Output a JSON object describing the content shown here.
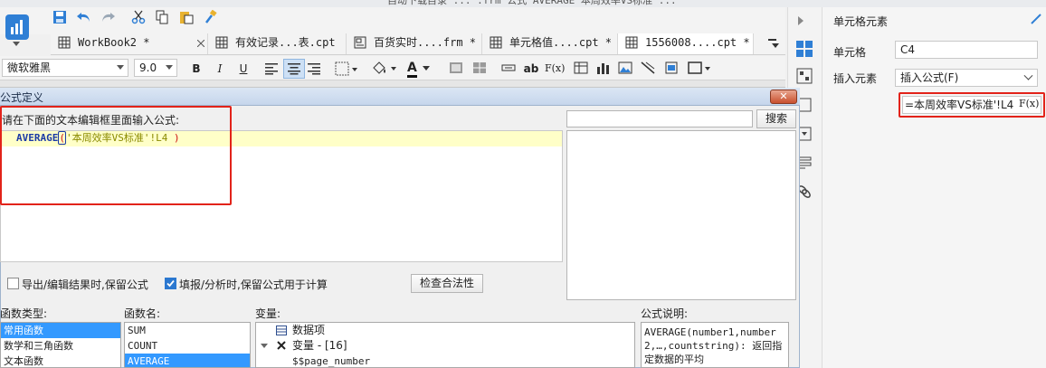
{
  "window": {
    "title_partial": "自动下载目录 ... .frm 公式 AVERAGE 本周效率VS标准 ..."
  },
  "toolbar": {
    "save": "save",
    "undo": "undo",
    "redo": "redo",
    "cut": "cut",
    "copy": "copy",
    "paste": "paste",
    "format_painter": "brush"
  },
  "tabs": [
    {
      "label": "WorkBook2 *"
    },
    {
      "label": "有效记录...表.cpt"
    },
    {
      "label": "百货实时....frm *"
    },
    {
      "label": "单元格值....cpt *"
    },
    {
      "label": "1556008....cpt *"
    }
  ],
  "format": {
    "font_name": "微软雅黑",
    "font_size": "9.0",
    "bold": "B",
    "italic": "I",
    "underline": "U",
    "text_a": "A",
    "ab": "ab",
    "fx": "F(x)"
  },
  "dialog": {
    "title": "公式定义",
    "close": "✕",
    "prompt": "请在下面的文本编辑框里面输入公式:",
    "search_btn": "搜索",
    "search_value": "",
    "formula": {
      "func": "AVERAGE",
      "open": "(",
      "arg": "'本周效率VS标准'!L4",
      "close": ")"
    },
    "export_label": "导出/编辑结果时,保留公式",
    "export_checked": false,
    "fill_label": "填报/分析时,保留公式用于计算",
    "fill_checked": true,
    "check_btn": "检查合法性",
    "func_type_label": "函数类型:",
    "func_types": [
      "常用函数",
      "数学和三角函数",
      "文本函数"
    ],
    "func_name_label": "函数名:",
    "func_names": [
      "SUM",
      "COUNT",
      "AVERAGE"
    ],
    "var_label": "变量:",
    "vars": [
      {
        "label": "数据项",
        "icon": "table-icon"
      },
      {
        "label": "变量 - [16]",
        "icon": "variable-icon"
      },
      {
        "label": "$$page_number",
        "icon": ""
      }
    ],
    "desc_label": "公式说明:",
    "desc_text": "AVERAGE(number1,number2,…,countstring): 返回指定数据的平均"
  },
  "right_panel": {
    "title": "单元格元素",
    "cell_label": "单元格",
    "cell_value": "C4",
    "insert_label": "插入元素",
    "insert_value": "插入公式(F)",
    "formula_value": "=本周效率VS标准'!L4",
    "fx_btn": "F(x)"
  },
  "colors": {
    "accent": "#2f7fd5",
    "highlight": "#e2231a",
    "selection": "#3399ff"
  }
}
